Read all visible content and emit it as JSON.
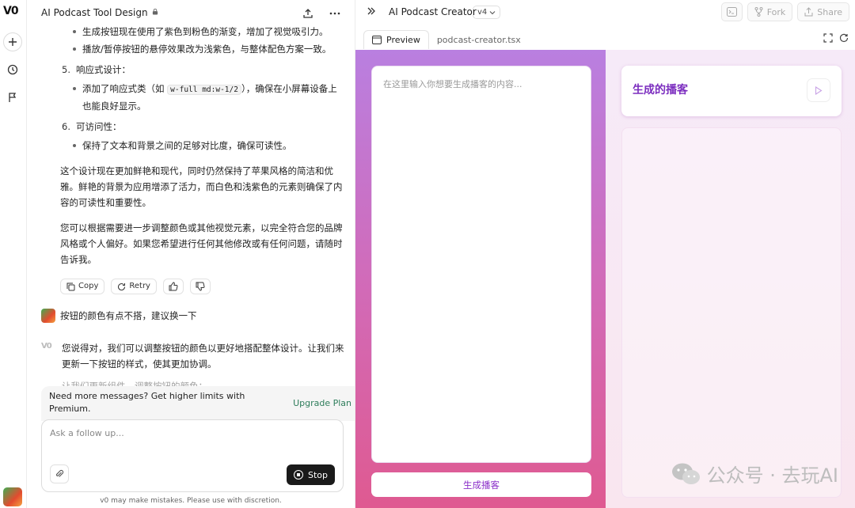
{
  "rail": {
    "logo": "V0"
  },
  "chat": {
    "title": "AI Podcast Tool Design",
    "bullets_top": [
      "生成按钮现在使用了紫色到粉色的渐变，增加了视觉吸引力。",
      "播放/暂停按钮的悬停效果改为浅紫色，与整体配色方案一致。"
    ],
    "item5": {
      "num": "5.",
      "label": "响应式设计："
    },
    "item5_bullet_pre": "添加了响应式类（如 ",
    "item5_code": "w-full md:w-1/2",
    "item5_bullet_post": "），确保在小屏幕设备上也能良好显示。",
    "item6": {
      "num": "6.",
      "label": "可访问性："
    },
    "item6_bullet": "保持了文本和背景之间的足够对比度，确保可读性。",
    "para1": "这个设计现在更加鲜艳和现代，同时仍然保持了苹果风格的简洁和优雅。鲜艳的背景为应用增添了活力，而白色和浅紫色的元素则确保了内容的可读性和重要性。",
    "para2": "您可以根据需要进一步调整颜色或其他视觉元素，以完全符合您的品牌风格或个人偏好。如果您希望进行任何其他修改或有任何问题，请随时告诉我。",
    "copy_label": "Copy",
    "retry_label": "Retry",
    "user_message": "按钮的颜色有点不搭，建议换一下",
    "bot_label": "V0",
    "bot_message": "您说得对，我们可以调整按钮的颜色以更好地搭配整体设计。让我们来更新一下按钮的样式，使其更加协调。",
    "bot_message_partial": "让我们更新组件，调整按钮的颜色：",
    "upgrade_text": "Need more messages? Get higher limits with Premium.",
    "upgrade_link": "Upgrade Plan",
    "upgrade_close": "×",
    "composer_placeholder": "Ask a follow up...",
    "stop_label": "Stop",
    "disclaimer": "v0 may make mistakes. Please use with discretion."
  },
  "right": {
    "title": "AI Podcast Creator",
    "version": "v4",
    "fork_label": "Fork",
    "share_label": "Share",
    "tab_preview": "Preview",
    "tab_file": "podcast-creator.tsx"
  },
  "preview": {
    "textarea_placeholder": "在这里输入你想要生成播客的内容...",
    "generate_button": "生成播客",
    "card_title": "生成的播客"
  },
  "watermark": {
    "text": "公众号 · 去玩AI"
  },
  "colors": {
    "accent_purple": "#7b2dbf",
    "gradient_top": "#b97fe0",
    "gradient_bottom": "#df5a91",
    "upgrade_link": "#2e7d5b"
  }
}
